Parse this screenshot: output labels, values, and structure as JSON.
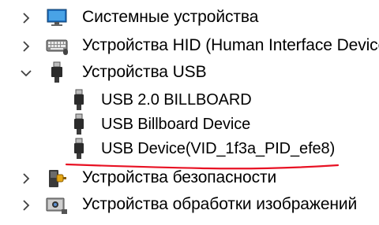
{
  "tree": {
    "items": [
      {
        "label": "Системные устройства",
        "expanded": false,
        "icon": "computer-icon"
      },
      {
        "label": "Устройства HID (Human Interface Device",
        "expanded": false,
        "icon": "keyboard-icon"
      },
      {
        "label": "Устройства USB",
        "expanded": true,
        "icon": "usb-plug-icon",
        "children": [
          {
            "label": "USB 2.0 BILLBOARD",
            "icon": "usb-plug-icon"
          },
          {
            "label": "USB Billboard Device",
            "icon": "usb-plug-icon"
          },
          {
            "label": "USB Device(VID_1f3a_PID_efe8)",
            "icon": "usb-plug-icon"
          }
        ]
      },
      {
        "label": "Устройства безопасности",
        "expanded": false,
        "icon": "security-key-icon"
      },
      {
        "label": "Устройства обработки изображений",
        "expanded": false,
        "icon": "camera-icon"
      }
    ]
  },
  "annotation": {
    "color": "#e81123"
  }
}
